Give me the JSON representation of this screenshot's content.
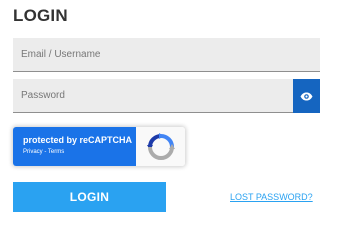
{
  "form": {
    "title": "LOGIN",
    "email_placeholder": "Email / Username",
    "email_value": "",
    "password_placeholder": "Password",
    "password_value": "",
    "eye_icon": "eye-icon",
    "login_label": "LOGIN",
    "lost_password_label": "LOST PASSWORD?"
  },
  "recaptcha": {
    "line1": "protected by reCAPTCHA",
    "line2": "Privacy - Terms",
    "logo_icon": "recaptcha-logo-icon"
  },
  "colors": {
    "accent": "#2aa2f1",
    "eye_button": "#1565c0",
    "recaptcha_blue": "#1a73e8",
    "field_bg": "#ececec"
  }
}
